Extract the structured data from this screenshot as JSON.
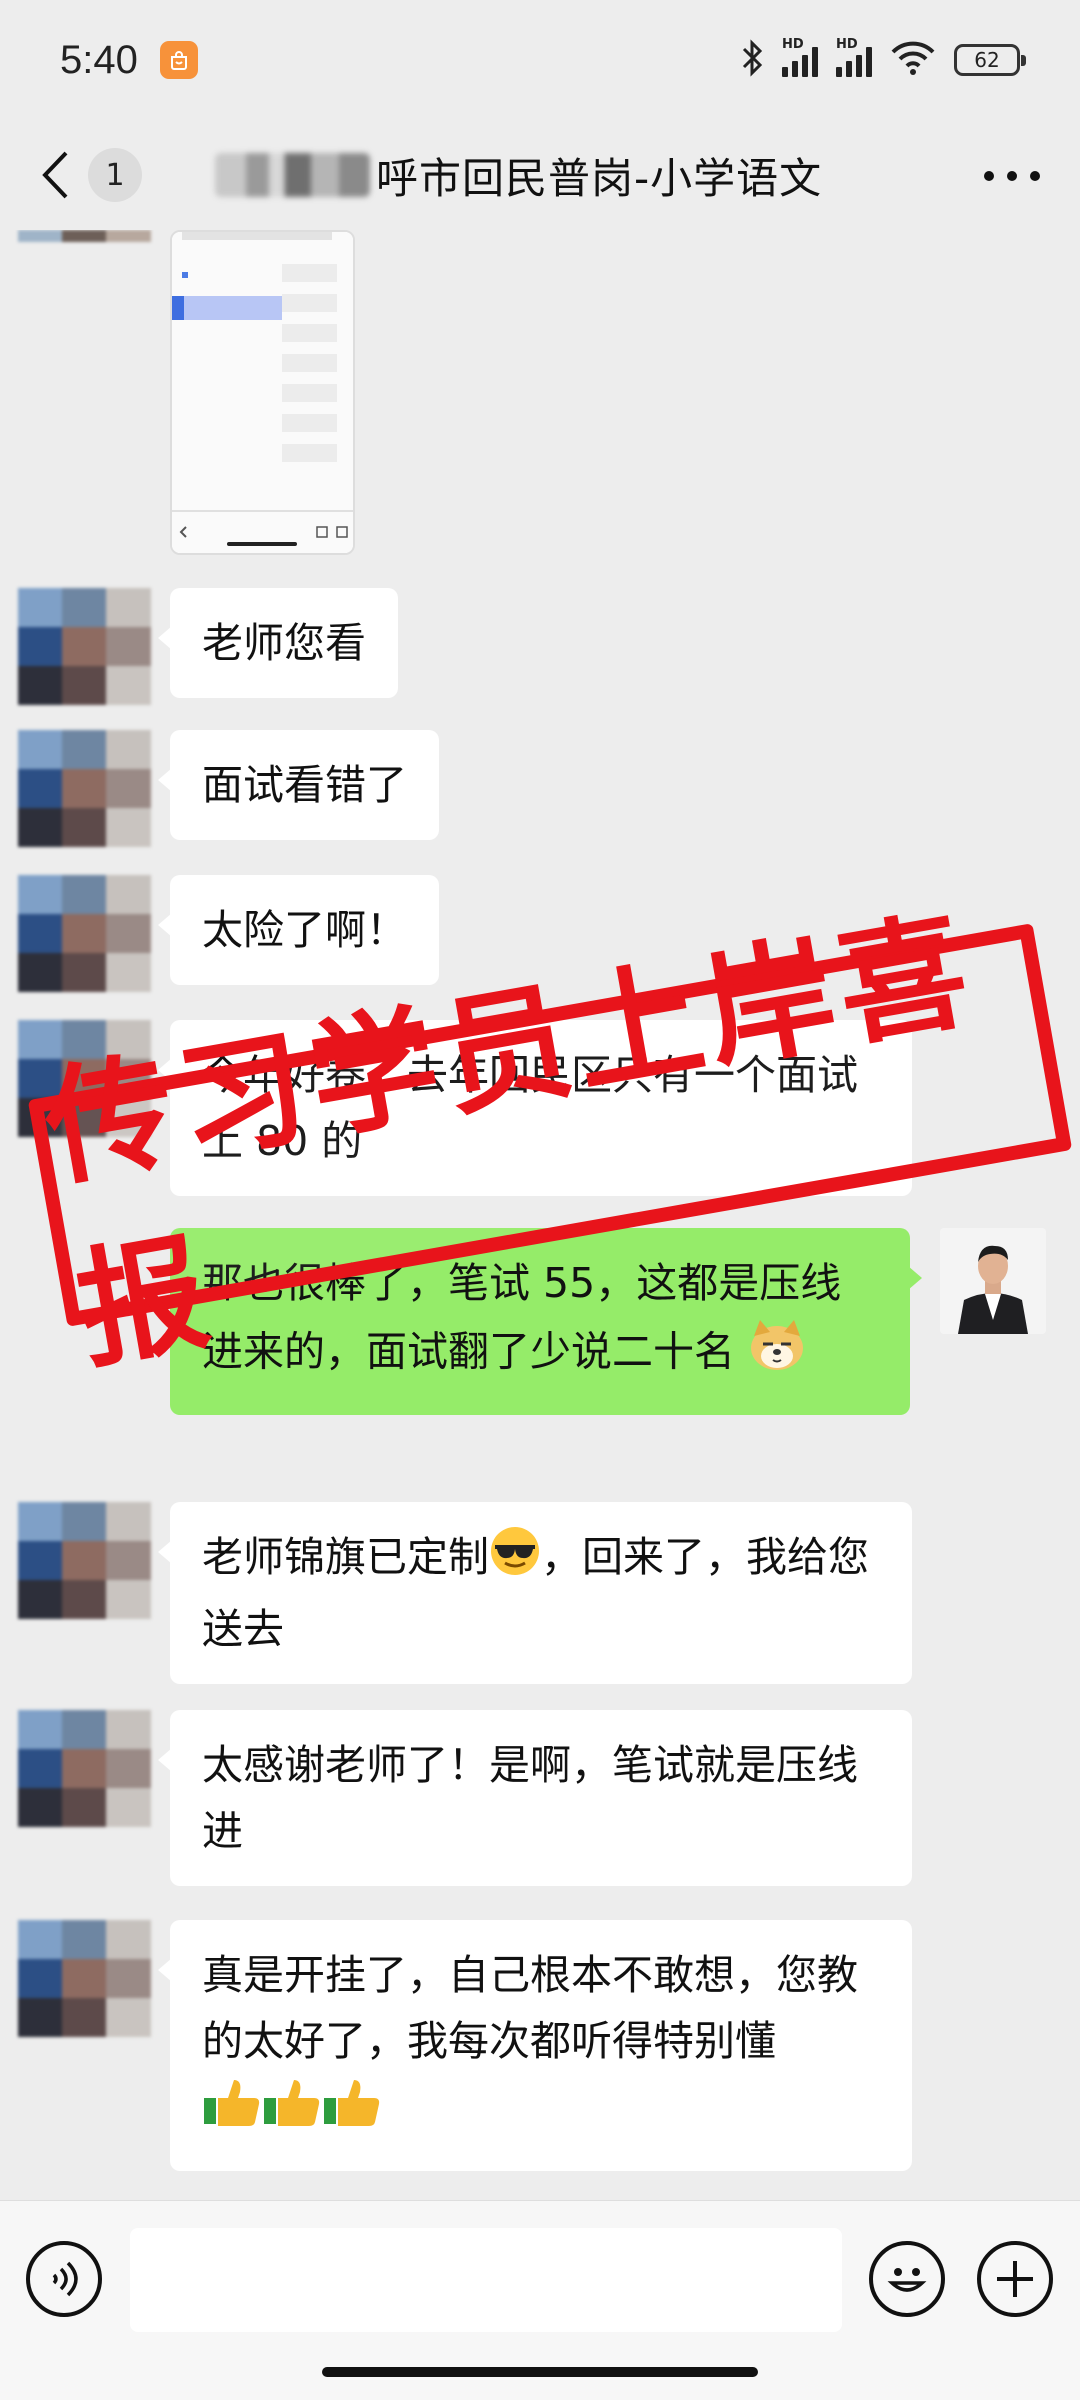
{
  "status_bar": {
    "time": "5:40",
    "battery": "62",
    "hd_label": "HD",
    "icons": [
      "app-notification-icon",
      "bluetooth-icon",
      "signal-hd-icon",
      "signal-hd-icon",
      "wifi-icon",
      "battery-icon"
    ]
  },
  "header": {
    "unread_count": "1",
    "title": "呼市回民普岗-小学语文",
    "icons": [
      "back-arrow-icon",
      "more-icon"
    ]
  },
  "stamp": {
    "text": "传习学员上岸喜报",
    "color": "#e8141b"
  },
  "messages": [
    {
      "sender": "other",
      "text": "老师您看"
    },
    {
      "sender": "other",
      "text": "面试看错了"
    },
    {
      "sender": "other",
      "text": "太险了啊！"
    },
    {
      "sender": "other",
      "text": "今年好卷，去年回民区只有一个面试上 80 的"
    },
    {
      "sender": "me",
      "text": "那也很棒了，笔试 55，这都是压线进来的，面试翻了少说二十名",
      "emoji": "doge-emoji"
    },
    {
      "sender": "other",
      "text_before": "老师锦旗已定制",
      "emoji": "cool-sunglasses-emoji",
      "text_after": "，回来了，我给您送去"
    },
    {
      "sender": "other",
      "text": "太感谢老师了！是啊，笔试就是压线进"
    },
    {
      "sender": "other",
      "text": "真是开挂了，自己根本不敢想，您教的太好了，我每次都听得特别懂",
      "emoji": "thumbs-up-emoji x3"
    }
  ],
  "input_bar": {
    "placeholder": "",
    "icons": [
      "voice-icon",
      "emoji-icon",
      "plus-icon"
    ]
  },
  "colors": {
    "background": "#ededed",
    "my_bubble": "#95ec69",
    "other_bubble": "#ffffff",
    "stamp": "#e8141b"
  }
}
